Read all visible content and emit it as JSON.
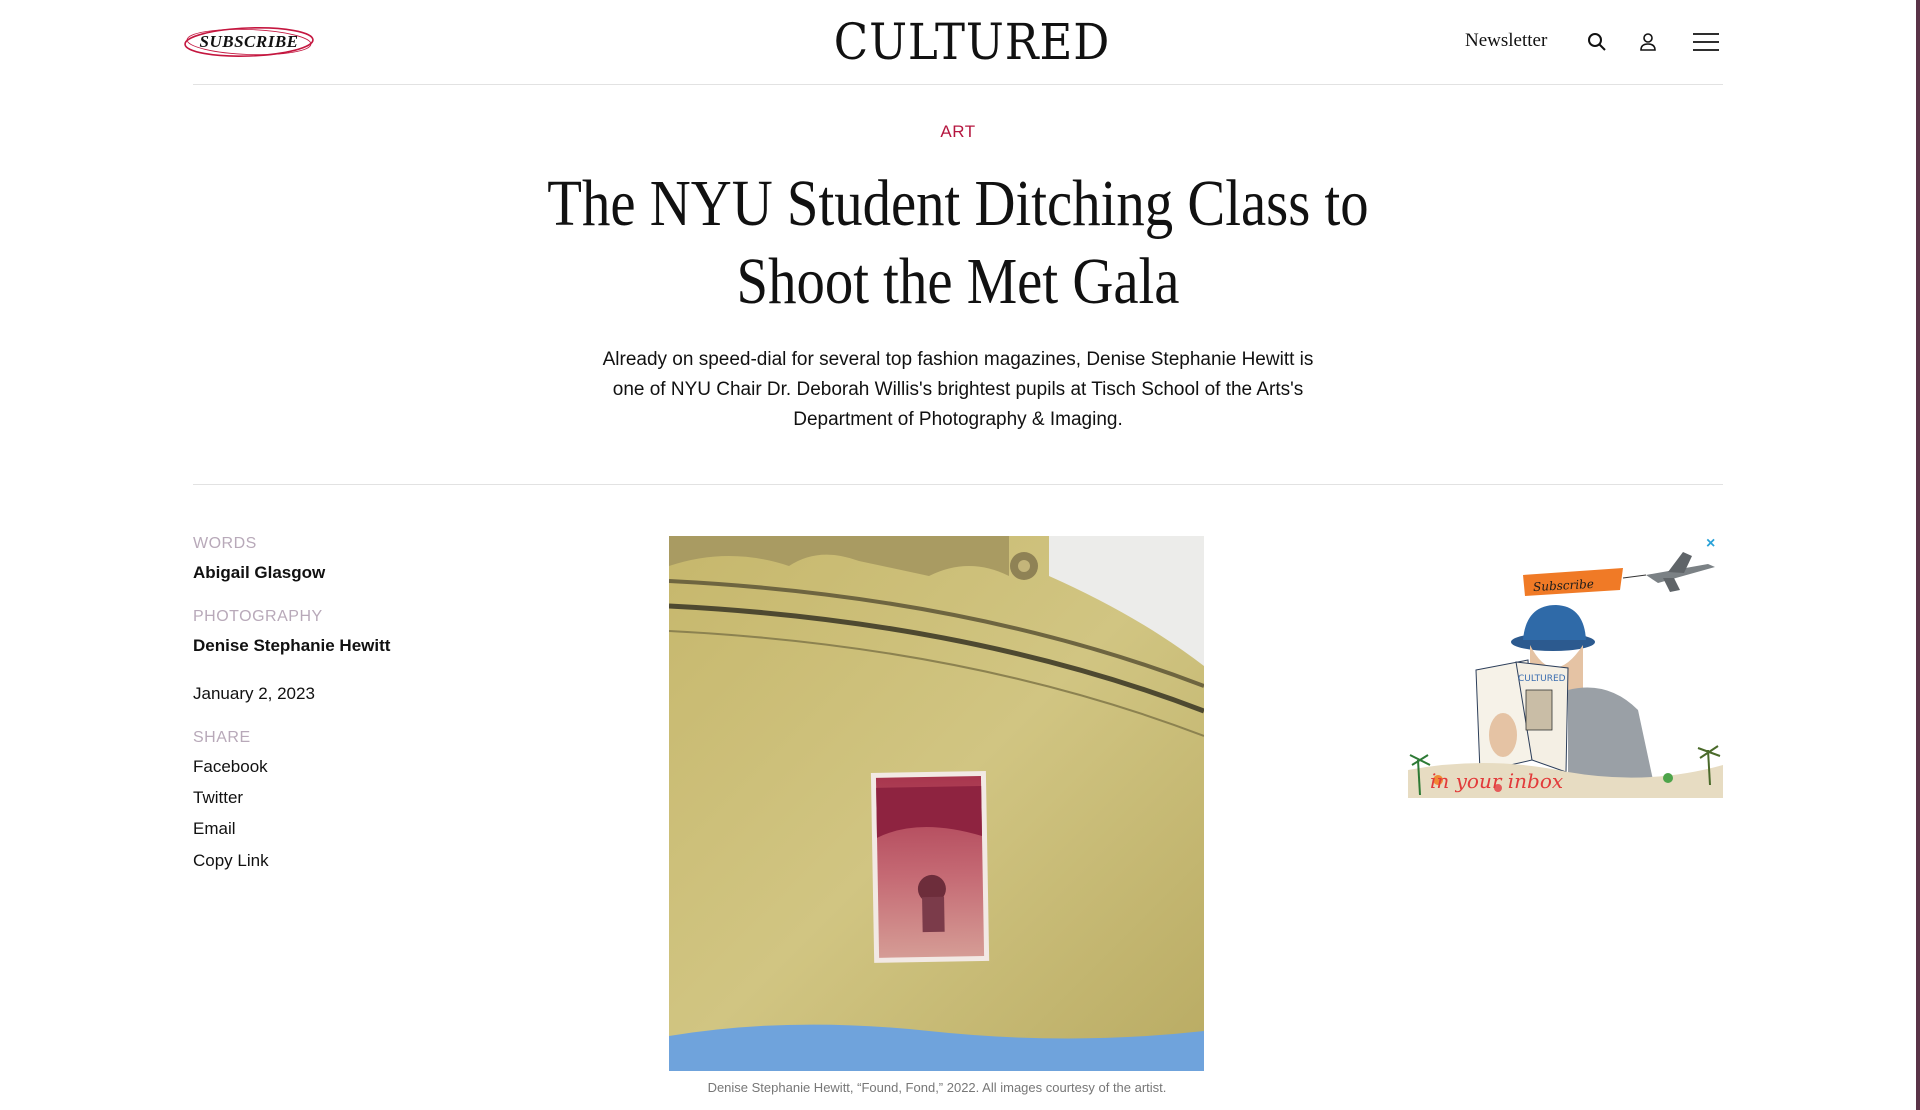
{
  "header": {
    "subscribe_label": "SUBSCRIBE",
    "logo_text": "CULTURED",
    "newsletter_label": "Newsletter",
    "icons": [
      "search-icon",
      "user-icon",
      "menu-icon"
    ]
  },
  "article": {
    "category": "ART",
    "headline": "The NYU Student Ditching Class to Shoot the Met Gala",
    "dek": "Already on speed-dial for several top fashion magazines, Denise Stephanie Hewitt is one of NYU Chair Dr. Deborah Willis's brightest pupils at Tisch School of the Arts's Department of Photography & Imaging.",
    "words_label": "WORDS",
    "author": "Abigail Glasgow",
    "photography_label": "PHOTOGRAPHY",
    "photographer": "Denise Stephanie Hewitt",
    "date": "January 2, 2023",
    "share_label": "SHARE",
    "share_links": [
      "Facebook",
      "Twitter",
      "Email",
      "Copy Link"
    ],
    "image_caption": "Denise Stephanie Hewitt, “Found, Fond,” 2022. All images courtesy of the artist."
  },
  "ad": {
    "banner_text": "Subscribe",
    "magazine_text": "CULTURED",
    "tagline": "in your inbox",
    "close_glyph": "×"
  },
  "colors": {
    "accent": "#b5163f",
    "meta_label": "#b8a9b9",
    "ad_close": "#2aa2d8"
  }
}
